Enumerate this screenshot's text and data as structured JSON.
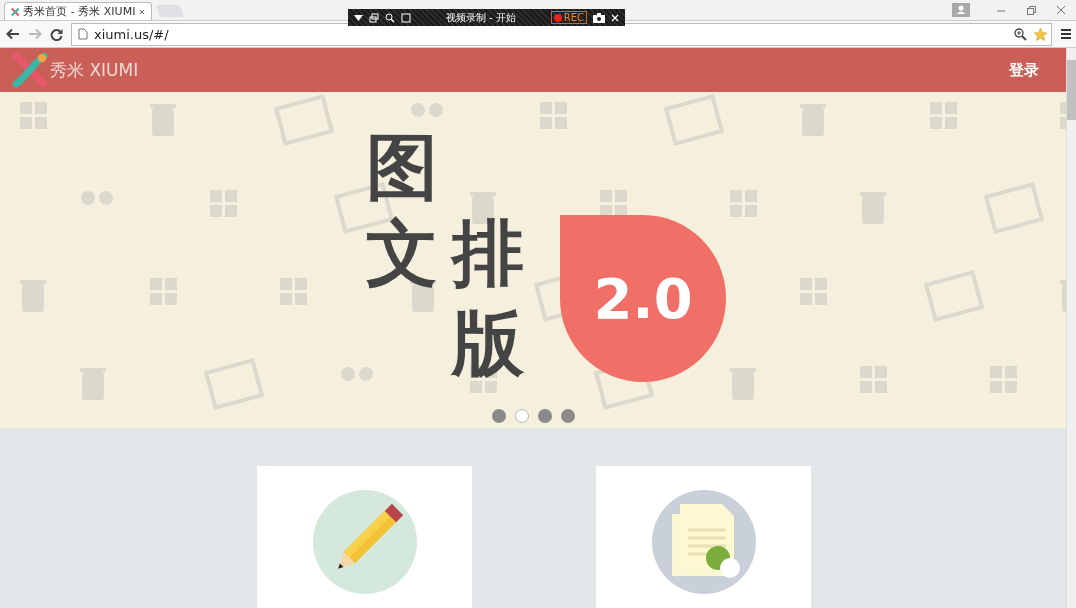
{
  "browser": {
    "tab": {
      "title": "秀米首页 - 秀米 XIUMI",
      "selected": true
    },
    "url": "xiumi.us/#/"
  },
  "recorder": {
    "title": "视频录制 - 开始",
    "rec": "REC"
  },
  "site": {
    "brand": "秀米 XIUMI",
    "login": "登录",
    "banner": {
      "title_chars": [
        "图",
        "文",
        "排",
        "版"
      ],
      "badge": "2.0",
      "dots": [
        {
          "selected": false
        },
        {
          "selected": true
        },
        {
          "selected": false
        },
        {
          "selected": false
        }
      ]
    },
    "cards": [
      {
        "kind": "pencil"
      },
      {
        "kind": "document"
      }
    ]
  }
}
